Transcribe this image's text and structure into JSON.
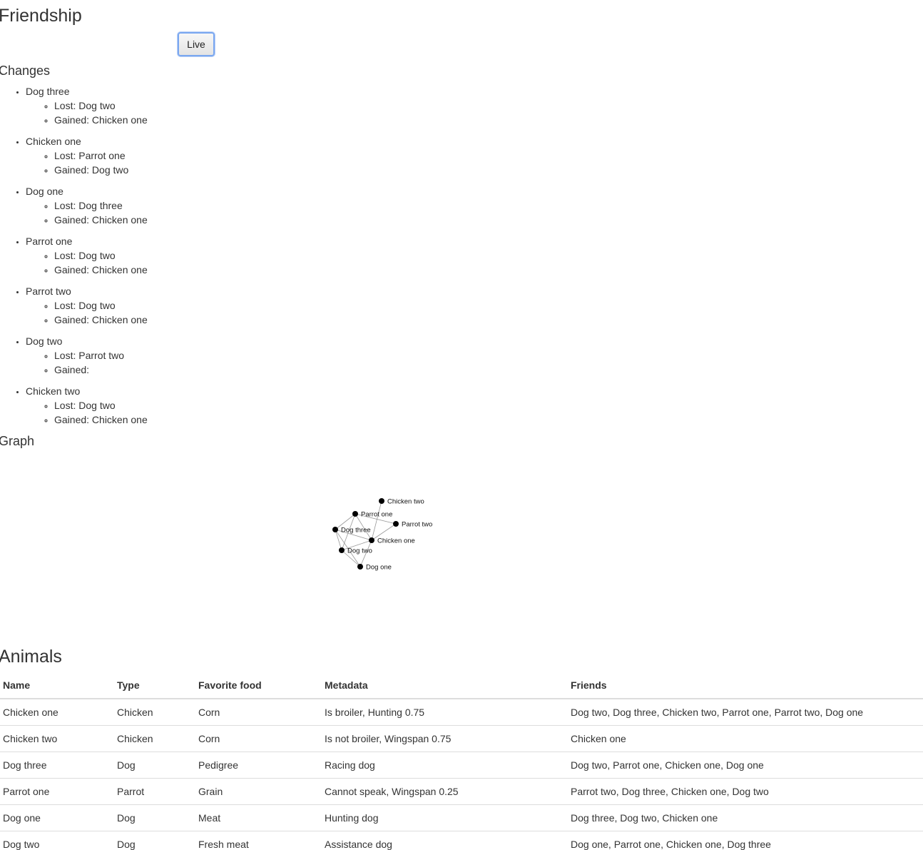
{
  "page": {
    "title": "Friendship",
    "live_button": "Live"
  },
  "changes": {
    "heading": "Changes",
    "items": [
      {
        "name": "Dog three",
        "lost": "Lost: Dog two",
        "gained": "Gained: Chicken one"
      },
      {
        "name": "Chicken one",
        "lost": "Lost: Parrot one",
        "gained": "Gained: Dog two"
      },
      {
        "name": "Dog one",
        "lost": "Lost: Dog three",
        "gained": "Gained: Chicken one"
      },
      {
        "name": "Parrot one",
        "lost": "Lost: Dog two",
        "gained": "Gained: Chicken one"
      },
      {
        "name": "Parrot two",
        "lost": "Lost: Dog two",
        "gained": "Gained: Chicken one"
      },
      {
        "name": "Dog two",
        "lost": "Lost: Parrot two",
        "gained": "Gained:"
      },
      {
        "name": "Chicken two",
        "lost": "Lost: Dog two",
        "gained": "Gained: Chicken one"
      }
    ]
  },
  "graph": {
    "heading": "Graph",
    "nodes": [
      "Chicken two",
      "Parrot one",
      "Parrot two",
      "Dog three",
      "Chicken one",
      "Dog two",
      "Dog one"
    ],
    "edges": [
      [
        "Chicken one",
        "Dog two"
      ],
      [
        "Chicken one",
        "Dog three"
      ],
      [
        "Chicken one",
        "Chicken two"
      ],
      [
        "Chicken one",
        "Parrot one"
      ],
      [
        "Chicken one",
        "Parrot two"
      ],
      [
        "Chicken one",
        "Dog one"
      ],
      [
        "Dog three",
        "Dog two"
      ],
      [
        "Dog three",
        "Parrot one"
      ],
      [
        "Dog three",
        "Dog one"
      ],
      [
        "Parrot one",
        "Parrot two"
      ],
      [
        "Parrot one",
        "Dog two"
      ],
      [
        "Dog one",
        "Dog two"
      ]
    ]
  },
  "animals": {
    "heading": "Animals",
    "columns": [
      "Name",
      "Type",
      "Favorite food",
      "Metadata",
      "Friends"
    ],
    "rows": [
      [
        "Chicken one",
        "Chicken",
        "Corn",
        "Is broiler, Hunting 0.75",
        "Dog two, Dog three, Chicken two, Parrot one, Parrot two, Dog one"
      ],
      [
        "Chicken two",
        "Chicken",
        "Corn",
        "Is not broiler, Wingspan 0.75",
        "Chicken one"
      ],
      [
        "Dog three",
        "Dog",
        "Pedigree",
        "Racing dog",
        "Dog two, Parrot one, Chicken one, Dog one"
      ],
      [
        "Parrot one",
        "Parrot",
        "Grain",
        "Cannot speak, Wingspan 0.25",
        "Parrot two, Dog three, Chicken one, Dog two"
      ],
      [
        "Dog one",
        "Dog",
        "Meat",
        "Hunting dog",
        "Dog three, Dog two, Chicken one"
      ],
      [
        "Dog two",
        "Dog",
        "Fresh meat",
        "Assistance dog",
        "Dog one, Parrot one, Chicken one, Dog three"
      ]
    ]
  }
}
